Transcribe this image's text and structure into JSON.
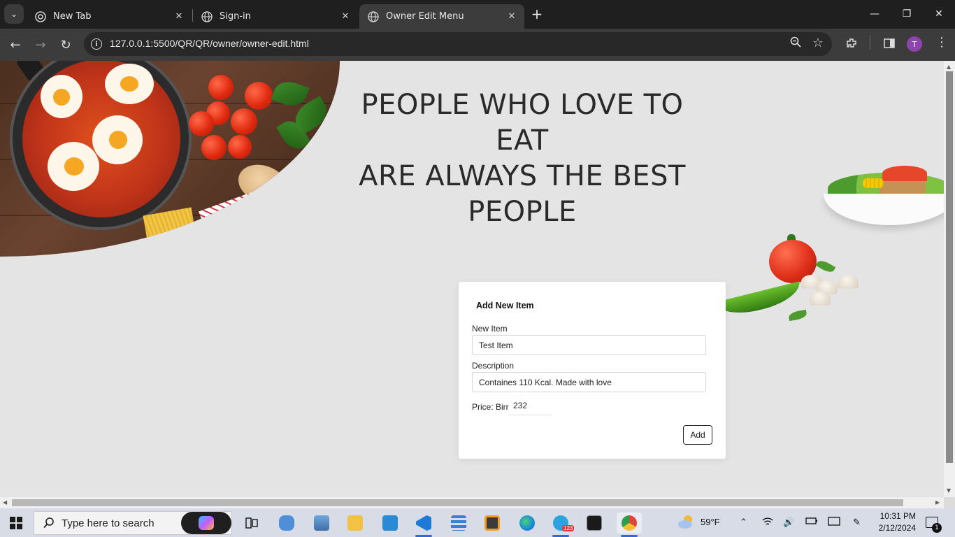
{
  "browser": {
    "tabs": [
      {
        "label": "New Tab",
        "icon": "chrome-icon",
        "active": false
      },
      {
        "label": "Sign-in",
        "icon": "globe-icon",
        "active": false
      },
      {
        "label": "Owner Edit Menu",
        "icon": "globe-icon",
        "active": true
      }
    ],
    "url": "127.0.0.1:5500/QR/QR/owner/owner-edit.html",
    "profile_initial": "T"
  },
  "hero": {
    "slogan_lines": [
      "PEOPLE WHO LOVE TO",
      "EAT",
      "ARE ALWAYS THE BEST",
      "PEOPLE"
    ]
  },
  "form": {
    "title": "Add New Item",
    "new_item_label": "New Item",
    "new_item_value": "Test Item",
    "description_label": "Description",
    "description_value": "Containes 110 Kcal. Made with love",
    "price_label": "Price: Birr",
    "price_value": "232",
    "add_button": "Add"
  },
  "taskbar": {
    "search_placeholder": "Type here to search",
    "weather_temp": "59°F",
    "time": "10:31 PM",
    "date": "2/12/2024",
    "telegram_badge": "123",
    "notification_count": "1"
  }
}
